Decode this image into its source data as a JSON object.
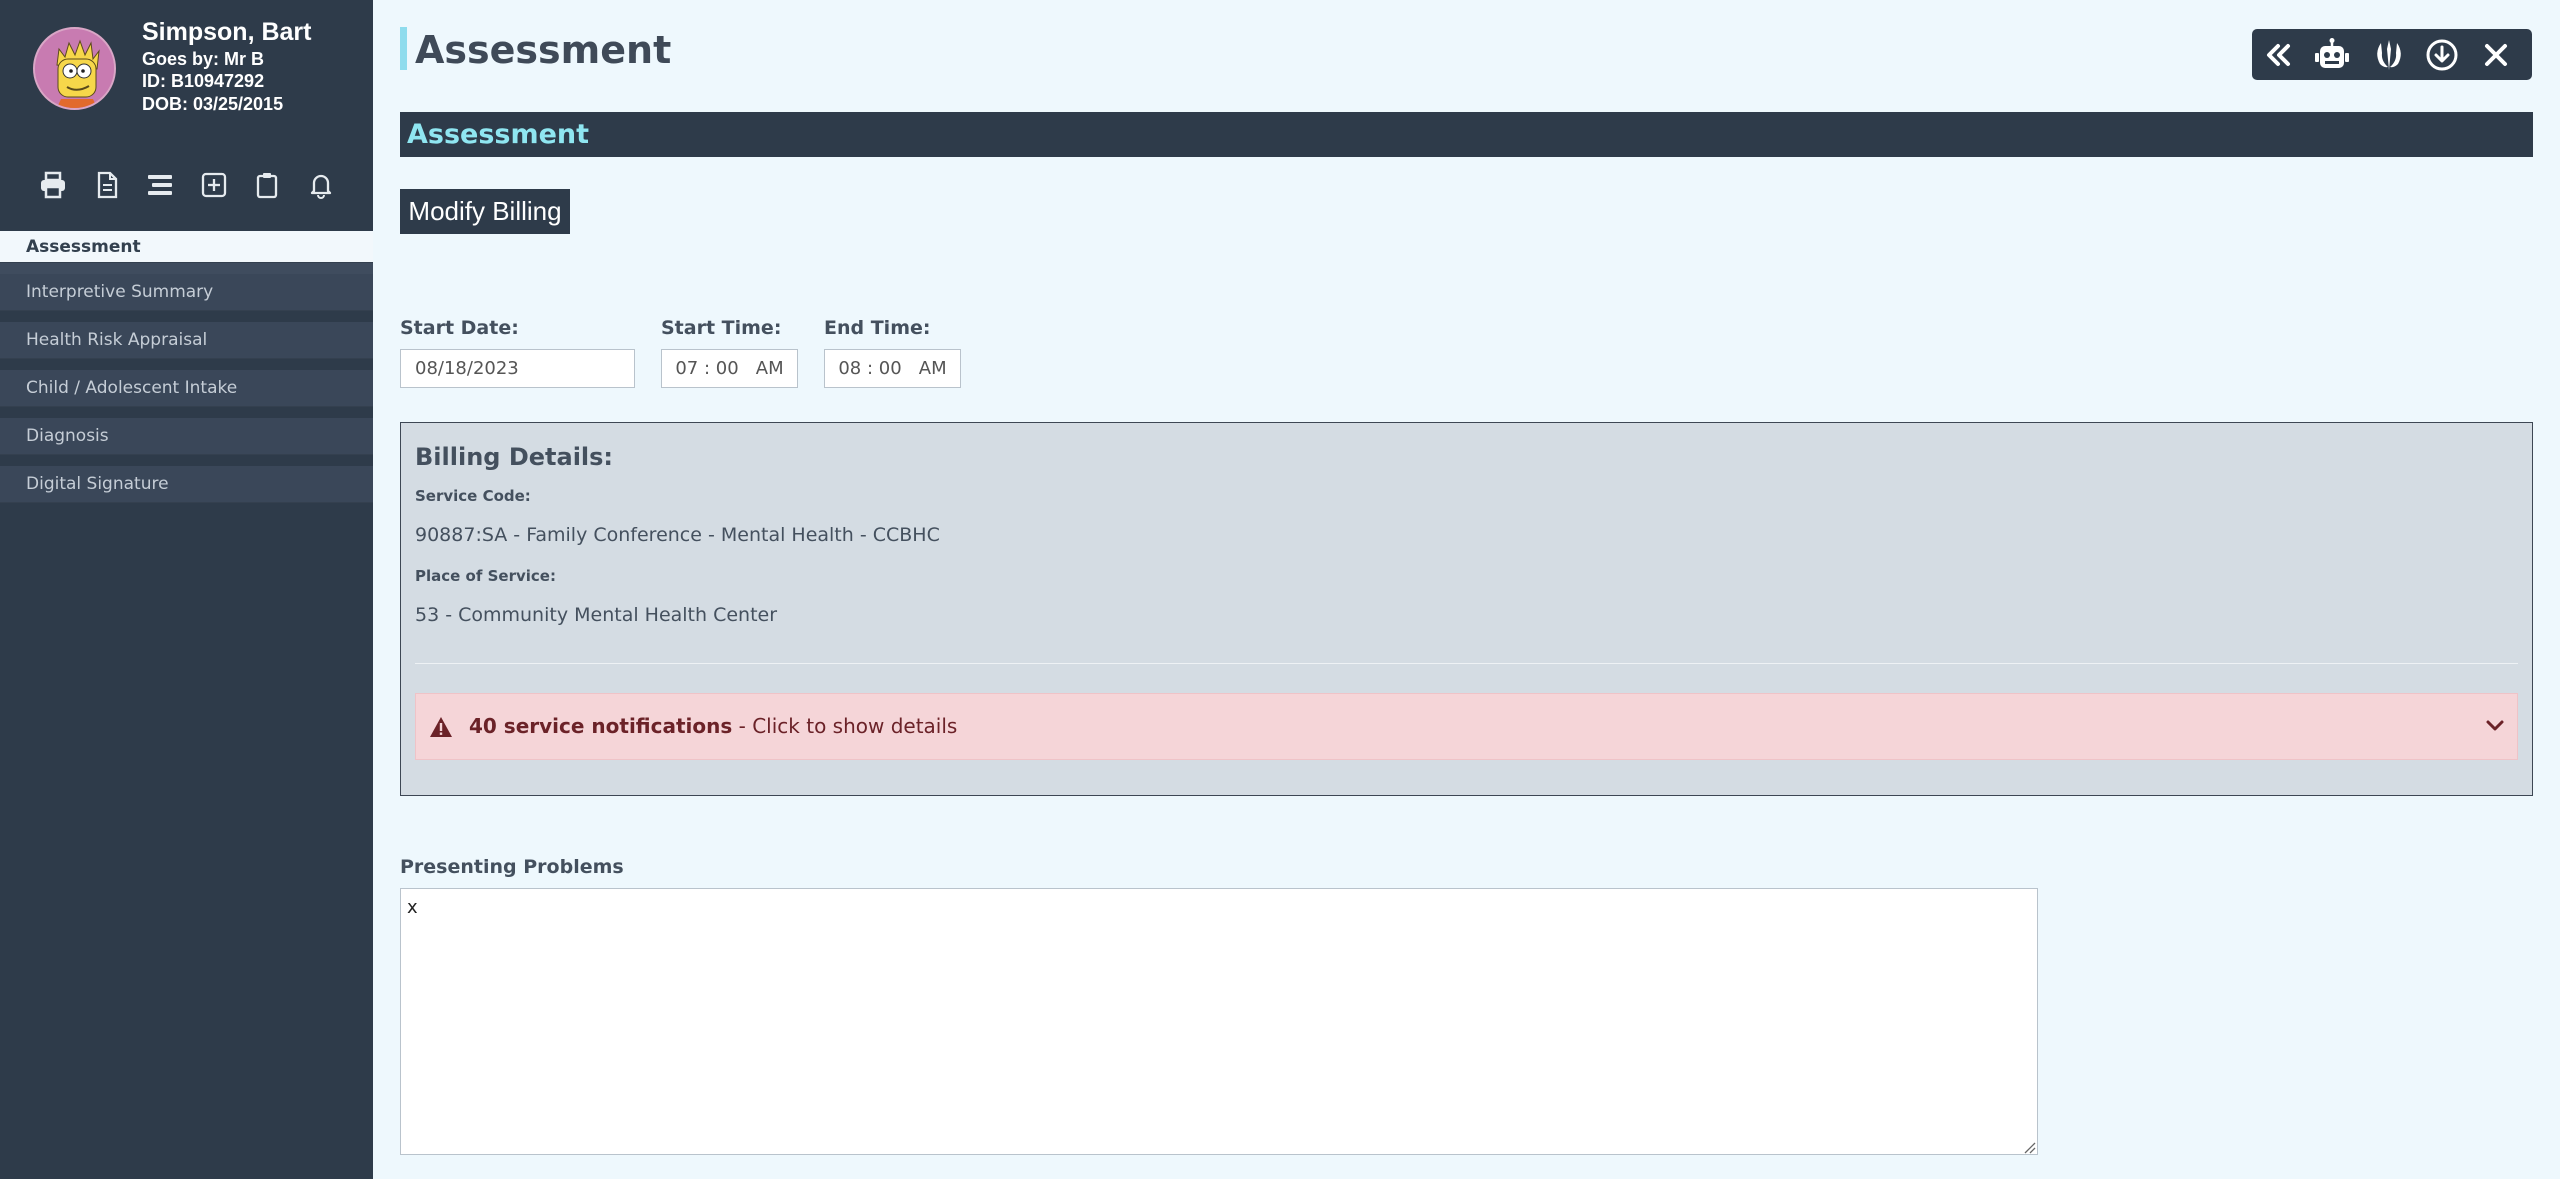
{
  "patient": {
    "name": "Simpson, Bart",
    "goes_by": "Goes by: Mr B",
    "id": "ID: B10947292",
    "dob": "DOB: 03/25/2015"
  },
  "toolbar_icons": [
    "print-icon",
    "document-icon",
    "list-icon",
    "plus-square-icon",
    "clipboard-icon",
    "bell-icon"
  ],
  "nav": {
    "items": [
      {
        "label": "Assessment",
        "active": true
      },
      {
        "label": "Interpretive Summary"
      },
      {
        "label": "Health Risk Appraisal"
      },
      {
        "label": "Child / Adolescent Intake"
      },
      {
        "label": "Diagnosis"
      },
      {
        "label": "Digital Signature"
      }
    ]
  },
  "page": {
    "title": "Assessment",
    "section_title": "Assessment",
    "modify_billing": "Modify Billing"
  },
  "top_actions": [
    "double-chevron-left-icon",
    "robot-icon",
    "jedi-icon",
    "download-circle-icon",
    "close-icon"
  ],
  "times": {
    "start_date_label": "Start Date:",
    "start_date_value": "08/18/2023",
    "start_time_label": "Start Time:",
    "start_time_value": "07 : 00   AM",
    "end_time_label": "End Time:",
    "end_time_value": "08 : 00   AM"
  },
  "billing": {
    "title": "Billing Details:",
    "service_code_label": "Service Code:",
    "service_code_value": "90887:SA - Family Conference - Mental Health - CCBHC",
    "place_label": "Place of Service:",
    "place_value": "53 - Community Mental Health Center",
    "alert_bold": "40 service notifications",
    "alert_rest": " - Click to show details"
  },
  "problems": {
    "label": "Presenting Problems",
    "value": "x"
  },
  "colors": {
    "sidebar": "#2e3b4a",
    "background": "#eef8fd",
    "accent": "#8fe6f1",
    "alert_bg": "#f5d5d8",
    "alert_text": "#6b2228"
  }
}
